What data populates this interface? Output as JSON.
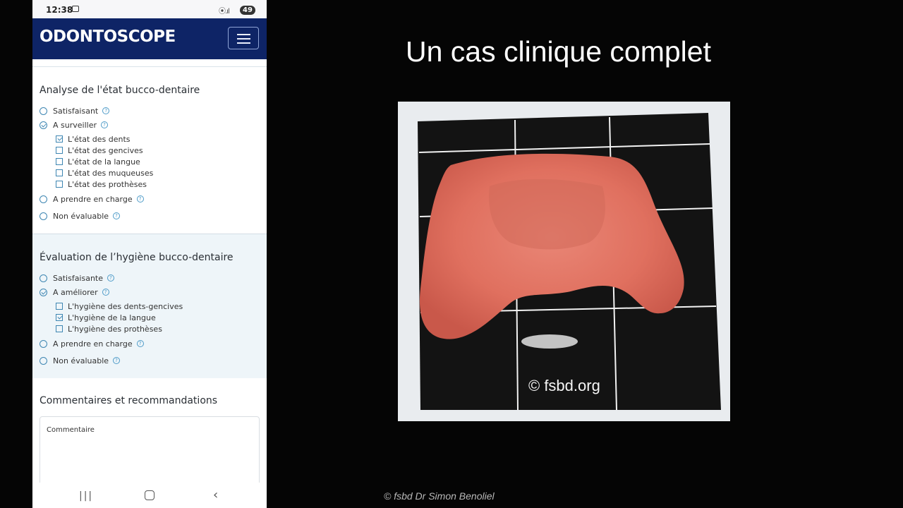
{
  "status_bar": {
    "time": "12:38",
    "battery": "49"
  },
  "app": {
    "logo": "ODONTOSCOPE"
  },
  "section_oral_state": {
    "title": "Analyse de l'état bucco-dentaire",
    "options": [
      {
        "label": "Satisfaisant",
        "checked": false
      },
      {
        "label": "A surveiller",
        "checked": true
      },
      {
        "label": "A prendre en charge",
        "checked": false
      },
      {
        "label": "Non évaluable",
        "checked": false
      }
    ],
    "sub_options": [
      {
        "label": "L'état des dents",
        "checked": true
      },
      {
        "label": "L'état des gencives",
        "checked": false
      },
      {
        "label": "L'état de la langue",
        "checked": false
      },
      {
        "label": "L'état des muqueuses",
        "checked": false
      },
      {
        "label": "L'état des prothèses",
        "checked": false
      }
    ]
  },
  "section_hygiene": {
    "title": "Évaluation de l’hygiène bucco-dentaire",
    "options": [
      {
        "label": "Satisfaisante",
        "checked": false
      },
      {
        "label": "A améliorer",
        "checked": true
      },
      {
        "label": "A prendre en charge",
        "checked": false
      },
      {
        "label": "Non évaluable",
        "checked": false
      }
    ],
    "sub_options": [
      {
        "label": "L'hygiène des dents-gencives",
        "checked": false
      },
      {
        "label": "L'hygiène de la langue",
        "checked": true
      },
      {
        "label": "L'hygiène des prothèses",
        "checked": false
      }
    ]
  },
  "section_comments": {
    "title": "Commentaires et recommandations",
    "comment_label": "Commentaire"
  },
  "help_glyph": "?",
  "slide": {
    "title": "Un cas clinique complet",
    "watermark": "© fsbd.org",
    "credit": "© fsbd Dr Simon Benoliel"
  },
  "icons": [
    "recent-apps-icon",
    "home-icon",
    "back-icon",
    "menu-icon",
    "help-icon"
  ],
  "colors": {
    "navbar": "#0e2466",
    "accent": "#3e86b2",
    "hygiene_bg": "#eef5f9",
    "slide_bg": "#050505"
  }
}
